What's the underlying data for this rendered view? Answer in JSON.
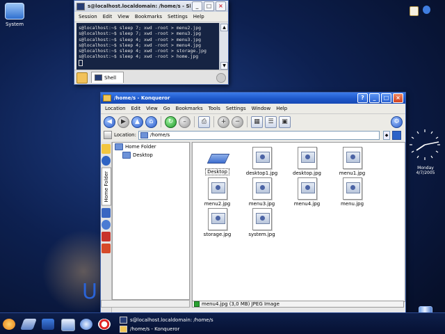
{
  "desktop": {
    "icons": [
      {
        "label": "System",
        "icon": "monitor-icon"
      }
    ],
    "watermark": "U"
  },
  "shell": {
    "title": "s@localhost.localdomain: /home/s - Shell - Konsole",
    "menu": [
      "Session",
      "Edit",
      "View",
      "Bookmarks",
      "Settings",
      "Help"
    ],
    "lines": [
      "s@localhost:~$ sleep 7; xwd -root > menu2.jpg",
      "s@localhost:~$ sleep 7; xwd -root > menu3.jpg",
      "s@localhost:~$ sleep 4; xwd -root > menu3.jpg",
      "s@localhost:~$ sleep 4; xwd -root > menu4.jpg",
      "s@localhost:~$ sleep 4; xwd -root > storage.jpg",
      "s@localhost:~$ sleep 4; xwd -root > home.jpg"
    ],
    "tab": "Shell"
  },
  "konqueror": {
    "title": "/home/s - Konqueror",
    "menu": [
      "Location",
      "Edit",
      "View",
      "Go",
      "Bookmarks",
      "Tools",
      "Settings",
      "Window",
      "Help"
    ],
    "location_label": "Location:",
    "location_value": "/home/s",
    "sidebar_tab": "Home Folder",
    "tree": {
      "root": "Home Folder",
      "child": "Desktop"
    },
    "files": [
      {
        "name": "Desktop",
        "type": "folder",
        "selected": true
      },
      {
        "name": "desktop1.jpg",
        "type": "image"
      },
      {
        "name": "desktop.jpg",
        "type": "image"
      },
      {
        "name": "menu1.jpg",
        "type": "image"
      },
      {
        "name": "menu2.jpg",
        "type": "image"
      },
      {
        "name": "menu3.jpg",
        "type": "image"
      },
      {
        "name": "menu4.jpg",
        "type": "image"
      },
      {
        "name": "menu.jpg",
        "type": "image"
      },
      {
        "name": "storage.jpg",
        "type": "image"
      },
      {
        "name": "system.jpg",
        "type": "image"
      }
    ],
    "status": "menu4.jpg (3,0 MB)  JPEG Image"
  },
  "clock": {
    "day": "Monday",
    "date": "4/7/2005"
  },
  "taskbar": {
    "entries": [
      {
        "label": "s@localhost.localdomain: /home/s"
      },
      {
        "label": "/home/s - Konqueror"
      }
    ]
  }
}
